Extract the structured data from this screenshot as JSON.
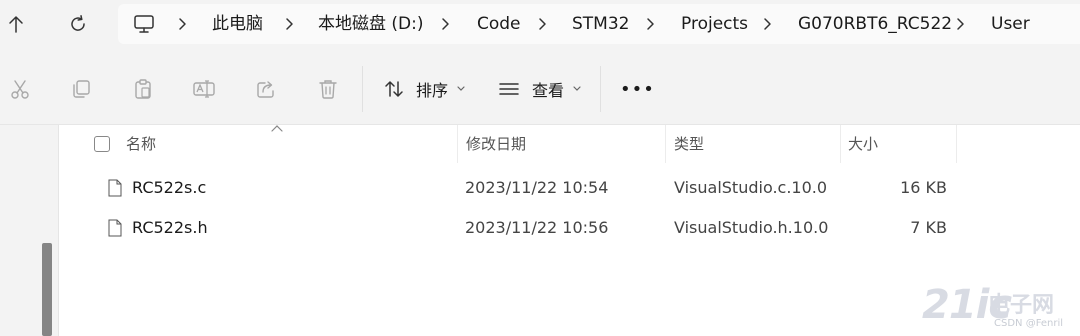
{
  "nav": {
    "breadcrumb": [
      "此电脑",
      "本地磁盘 (D:)",
      "Code",
      "STM32",
      "Projects",
      "G070RBT6_RC522",
      "User"
    ]
  },
  "toolbar": {
    "tools": [
      "cut-icon",
      "copy-icon",
      "paste-icon",
      "rename-icon",
      "share-icon",
      "delete-icon"
    ],
    "sort_label": "排序",
    "view_label": "查看",
    "more_label": "•••"
  },
  "columns": {
    "name": "名称",
    "modified": "修改日期",
    "type": "类型",
    "size": "大小"
  },
  "files": [
    {
      "name": "RC522s.c",
      "modified": "2023/11/22 10:54",
      "type": "VisualStudio.c.10.0",
      "size": "16 KB"
    },
    {
      "name": "RC522s.h",
      "modified": "2023/11/22 10:56",
      "type": "VisualStudio.h.10.0",
      "size": "7 KB"
    }
  ],
  "watermark": {
    "logo": "21ic",
    "name": "电子网",
    "site": "CSDN @Fenril"
  }
}
